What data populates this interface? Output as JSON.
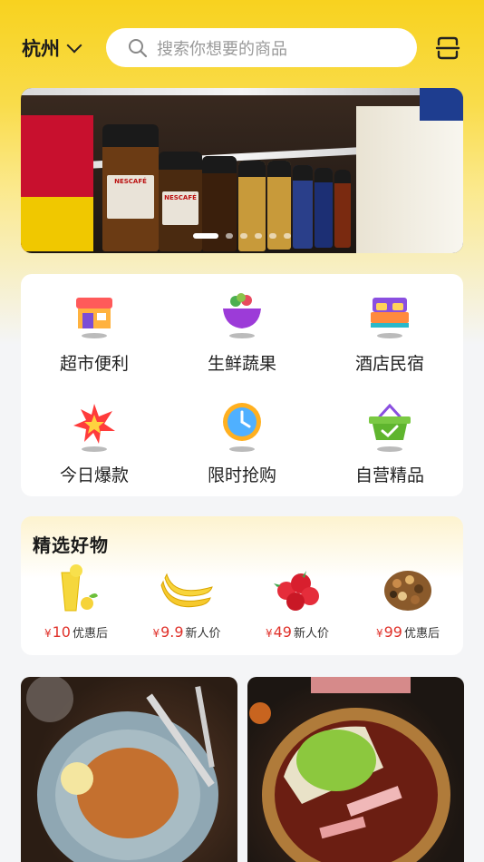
{
  "header": {
    "city": "杭州",
    "search_placeholder": "搜索你想要的商品"
  },
  "banner": {
    "brand_text": "NESCAFÉ",
    "slides_total": 6,
    "active_slide": 1
  },
  "categories": [
    {
      "label": "超市便利",
      "icon": "storefront-icon"
    },
    {
      "label": "生鲜蔬果",
      "icon": "fruit-basket-icon"
    },
    {
      "label": "酒店民宿",
      "icon": "bed-icon"
    },
    {
      "label": "今日爆款",
      "icon": "burst-star-icon"
    },
    {
      "label": "限时抢购",
      "icon": "clock-icon"
    },
    {
      "label": "自营精品",
      "icon": "shopping-basket-icon"
    }
  ],
  "picks": {
    "title": "精选好物",
    "items": [
      {
        "yen": "¥",
        "price": "10",
        "tag": "优惠后",
        "icon": "lemon-juice-icon"
      },
      {
        "yen": "¥",
        "price": "9.9",
        "tag": "新人价",
        "icon": "banana-icon"
      },
      {
        "yen": "¥",
        "price": "49",
        "tag": "新人价",
        "icon": "strawberry-icon"
      },
      {
        "yen": "¥",
        "price": "99",
        "tag": "优惠后",
        "icon": "mixed-nuts-icon"
      }
    ]
  },
  "features": [
    {
      "icon": "pasta-dish-photo"
    },
    {
      "icon": "hotpot-photo"
    }
  ],
  "colors": {
    "accent_yellow": "#f8d21f",
    "price_red": "#e0322b"
  }
}
